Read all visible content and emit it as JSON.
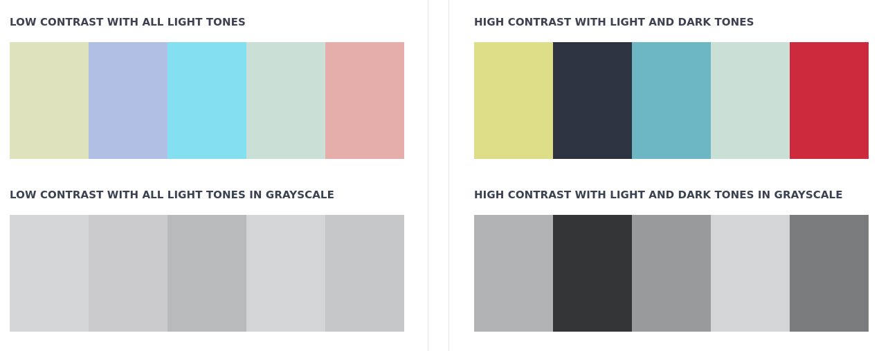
{
  "sections": [
    {
      "id": "s-low-color",
      "heading": "LOW CONTRAST WITH ALL LIGHT TONES",
      "swatches": [
        "#dfe3bd",
        "#b2bfe4",
        "#84dff1",
        "#cadfd5",
        "#e5aeab"
      ]
    },
    {
      "id": "s-high-color",
      "heading": "HIGH CONTRAST WITH LIGHT AND DARK TONES",
      "swatches": [
        "#dede88",
        "#2d3340",
        "#6db7c4",
        "#cadfd5",
        "#ce2a3e"
      ]
    },
    {
      "id": "s-low-gray",
      "heading": "LOW CONTRAST WITH ALL LIGHT TONES IN GRAYSCALE",
      "swatches": [
        "#d5d6d8",
        "#cbcbcd",
        "#b9babb",
        "#d4d5d6",
        "#c6c7c8"
      ]
    },
    {
      "id": "s-high-gray",
      "heading": "HIGH CONTRAST WITH LIGHT AND DARK TONES IN GRAYSCALE",
      "swatches": [
        "#b2b3b4",
        "#343537",
        "#999a9b",
        "#d4d5d6",
        "#7a7b7c"
      ]
    }
  ]
}
